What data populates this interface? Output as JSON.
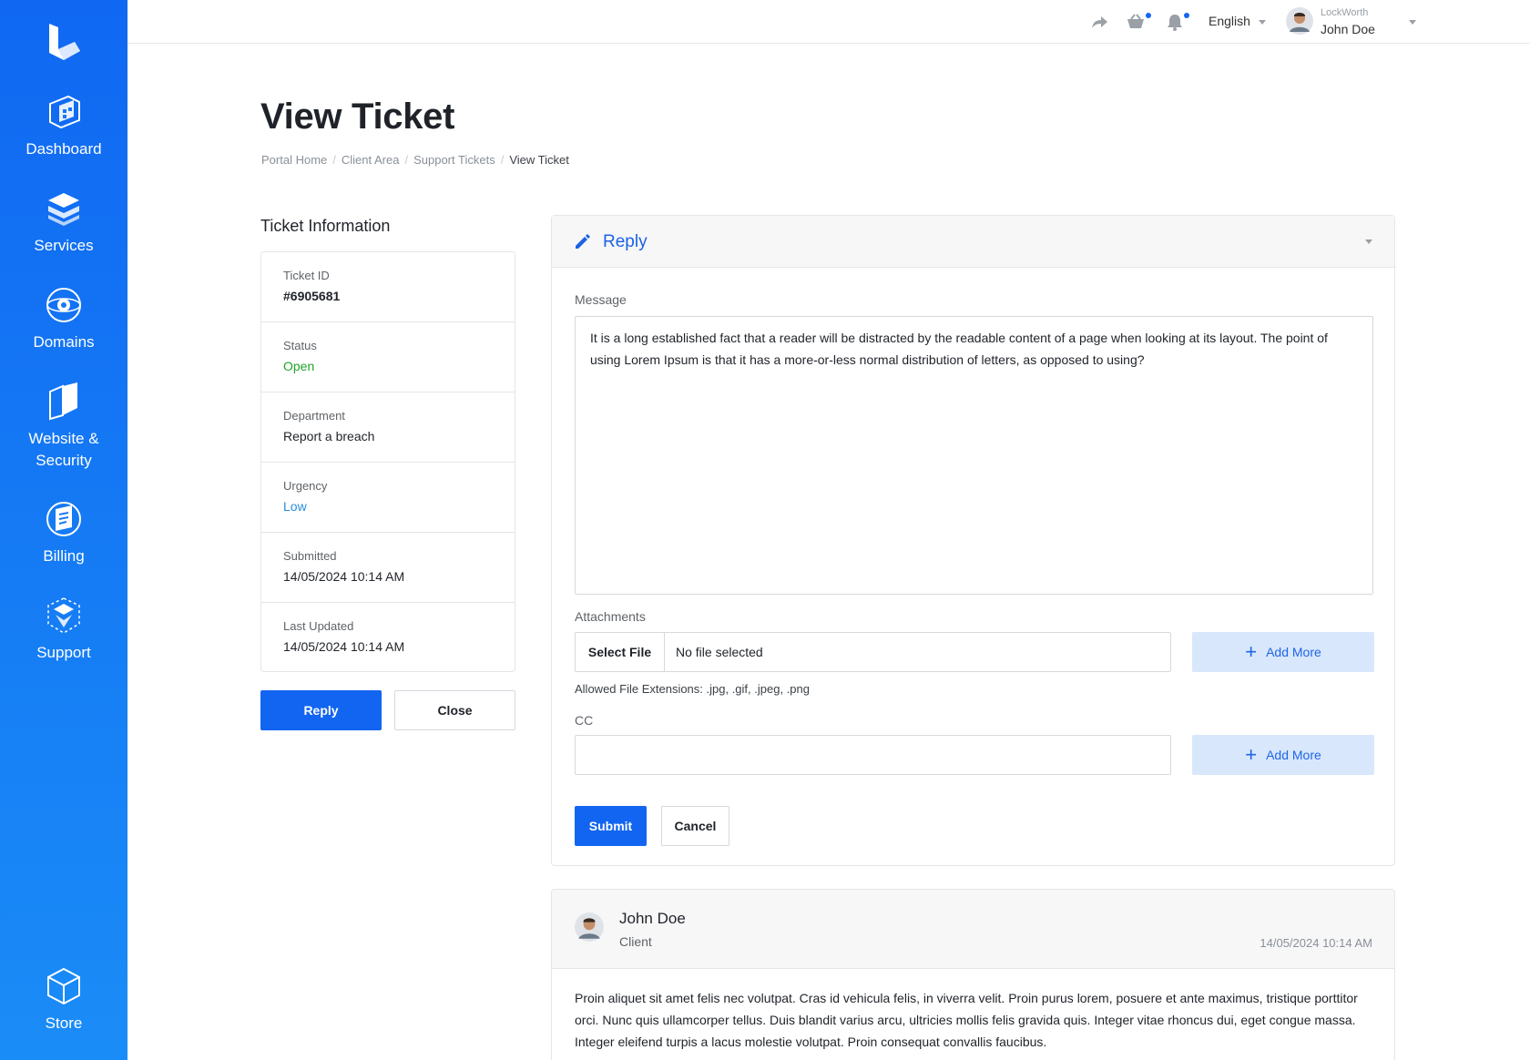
{
  "sidebar": {
    "items": [
      {
        "label": "Dashboard",
        "icon": "dashboard-icon"
      },
      {
        "label": "Services",
        "icon": "services-icon"
      },
      {
        "label": "Domains",
        "icon": "domains-icon"
      },
      {
        "label": "Website &",
        "label2": "Security",
        "icon": "website-security-icon"
      },
      {
        "label": "Billing",
        "icon": "billing-icon"
      },
      {
        "label": "Support",
        "icon": "support-icon"
      },
      {
        "label": "Store",
        "icon": "store-icon"
      }
    ]
  },
  "topbar": {
    "language": "English",
    "company": "LockWorth",
    "user_name": "John Doe"
  },
  "page": {
    "title": "View Ticket",
    "breadcrumb": [
      "Portal Home",
      "Client Area",
      "Support Tickets",
      "View Ticket"
    ]
  },
  "ticket_info": {
    "heading": "Ticket Information",
    "rows": [
      {
        "label": "Ticket ID",
        "value": "#6905681"
      },
      {
        "label": "Status",
        "value": "Open"
      },
      {
        "label": "Department",
        "value": "Report a breach"
      },
      {
        "label": "Urgency",
        "value": "Low"
      },
      {
        "label": "Submitted",
        "value": "14/05/2024 10:14 AM"
      },
      {
        "label": "Last Updated",
        "value": "14/05/2024 10:14 AM"
      }
    ],
    "reply_label": "Reply",
    "close_label": "Close"
  },
  "reply_form": {
    "title": "Reply",
    "message_label": "Message",
    "message_value": "It is a long established fact that a reader will be distracted by the readable content of a page when looking at its layout. The point of using Lorem Ipsum is that it has a more-or-less normal distribution of letters, as opposed to using?",
    "attachments_label": "Attachments",
    "select_file_label": "Select File",
    "no_file_label": "No file selected",
    "add_more_label": "Add More",
    "allowed_extensions": "Allowed File Extensions: .jpg, .gif, .jpeg, .png",
    "cc_label": "CC",
    "cc_value": "",
    "submit_label": "Submit",
    "cancel_label": "Cancel"
  },
  "thread": {
    "author": "John Doe",
    "role": "Client",
    "date": "14/05/2024 10:14 AM",
    "body": "Proin aliquet sit amet felis nec volutpat. Cras id vehicula felis, in viverra velit. Proin purus lorem, posuere et ante maximus, tristique porttitor orci. Nunc quis ullamcorper tellus. Duis blandit varius arcu, ultricies mollis felis gravida quis. Integer vitae rhoncus dui, eget congue massa. Integer eleifend turpis a lacus molestie volutpat. Proin consequat convallis faucibus."
  },
  "colors": {
    "primary": "#1265f0",
    "sidebar_top": "#1068f2",
    "sidebar_bottom": "#1a8cf7",
    "status_open": "#1fa32a",
    "urgency_low": "#2a8ddc",
    "add_more_bg": "#d9e7fc"
  }
}
